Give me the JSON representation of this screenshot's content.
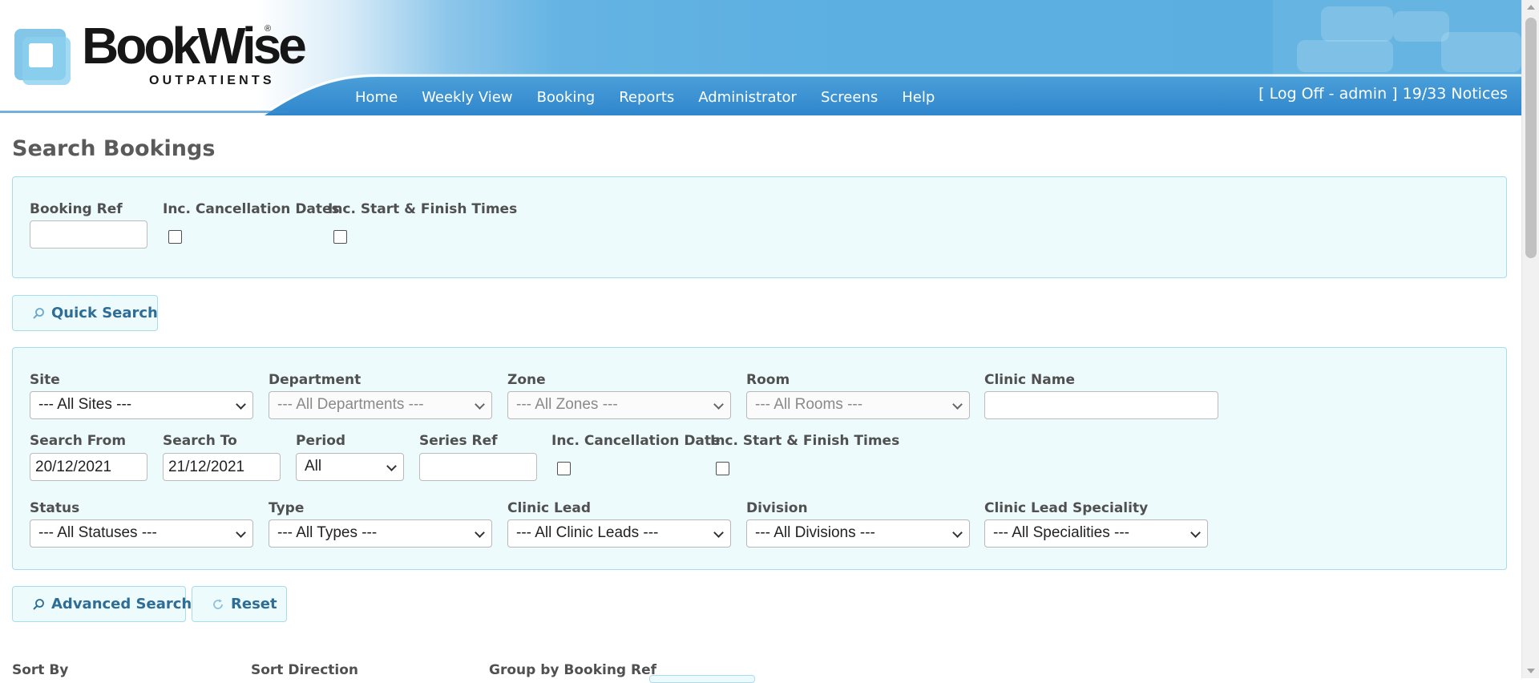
{
  "header": {
    "logo_text": "BookWise",
    "logo_registered": "®",
    "logo_subtext": "OUTPATIENTS",
    "menu": [
      {
        "label": "Home"
      },
      {
        "label": "Weekly View"
      },
      {
        "label": "Booking"
      },
      {
        "label": "Reports"
      },
      {
        "label": "Administrator"
      },
      {
        "label": "Screens"
      },
      {
        "label": "Help"
      }
    ],
    "user_text": "[ Log Off - admin ] 19/33 Notices"
  },
  "page_title": "Search Bookings",
  "quick": {
    "booking_ref_label": "Booking Ref",
    "booking_ref_value": "",
    "inc_cancel_label": "Inc. Cancellation Dates",
    "inc_times_label": "Inc. Start & Finish Times",
    "button_label": "Quick Search"
  },
  "advanced": {
    "site_label": "Site",
    "site_value": "--- All Sites ---",
    "department_label": "Department",
    "department_value": "--- All Departments ---",
    "zone_label": "Zone",
    "zone_value": "--- All Zones ---",
    "room_label": "Room",
    "room_value": "--- All Rooms ---",
    "clinic_name_label": "Clinic Name",
    "clinic_name_value": "",
    "search_from_label": "Search From",
    "search_from_value": "20/12/2021",
    "search_to_label": "Search To",
    "search_to_value": "21/12/2021",
    "period_label": "Period",
    "period_value": "All",
    "series_ref_label": "Series Ref",
    "series_ref_value": "",
    "inc_cancel_label": "Inc. Cancellation Date",
    "inc_times_label": "Inc. Start & Finish Times",
    "status_label": "Status",
    "status_value": "--- All Statuses ---",
    "type_label": "Type",
    "type_value": "--- All Types ---",
    "clinic_lead_label": "Clinic Lead",
    "clinic_lead_value": "--- All Clinic Leads ---",
    "division_label": "Division",
    "division_value": "--- All Divisions ---",
    "speciality_label": "Clinic Lead Speciality",
    "speciality_value": "--- All Specialities ---",
    "search_button_label": "Advanced Search",
    "reset_button_label": "Reset"
  },
  "sort": {
    "sort_by_label": "Sort By",
    "sort_direction_label": "Sort Direction",
    "group_by_label": "Group by Booking Ref"
  },
  "colors": {
    "menu_text": "#ffffff",
    "panel_bg": "#eefbfd",
    "panel_border": "#a5dcee",
    "button_text": "#2d6d96",
    "header_blue": "#5aaee0"
  }
}
